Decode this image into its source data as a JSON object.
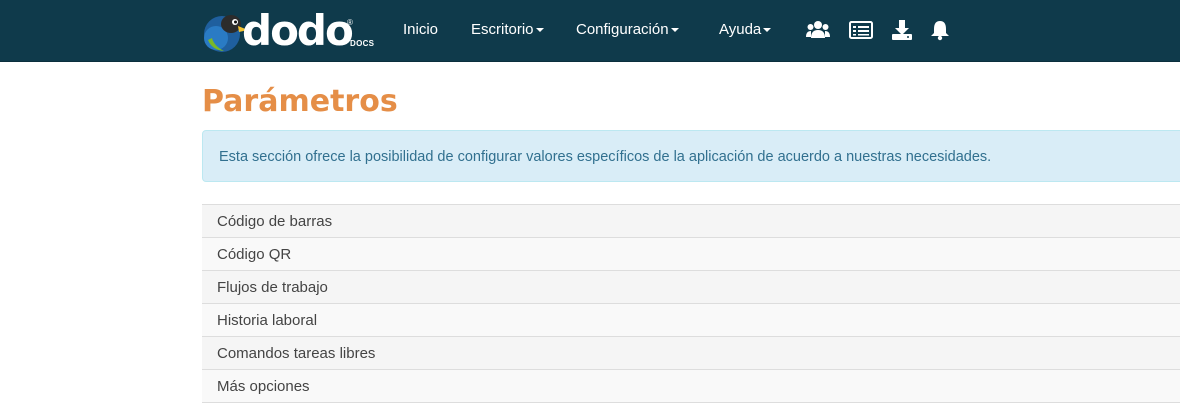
{
  "brand": {
    "name": "dodo",
    "registered": "®",
    "sub": "DOCS"
  },
  "nav": {
    "items": [
      {
        "label": "Inicio"
      },
      {
        "label": "Escritorio"
      },
      {
        "label": "Configuración"
      },
      {
        "label": "Ayuda"
      }
    ],
    "icons": [
      "users-icon",
      "list-icon",
      "download-icon",
      "bell-icon"
    ]
  },
  "page": {
    "title": "Parámetros",
    "info": "Esta sección ofrece la posibilidad de configurar valores específicos de la aplicación de acuerdo a nuestras necesidades."
  },
  "options": [
    {
      "label": "Código de barras"
    },
    {
      "label": "Código QR"
    },
    {
      "label": "Flujos de trabajo"
    },
    {
      "label": "Historia laboral"
    },
    {
      "label": "Comandos tareas libres"
    },
    {
      "label": "Más opciones"
    }
  ],
  "colors": {
    "navbar": "#0f3a4b",
    "title": "#e58e47",
    "info_bg": "#d9edf7",
    "info_text": "#31708f"
  }
}
